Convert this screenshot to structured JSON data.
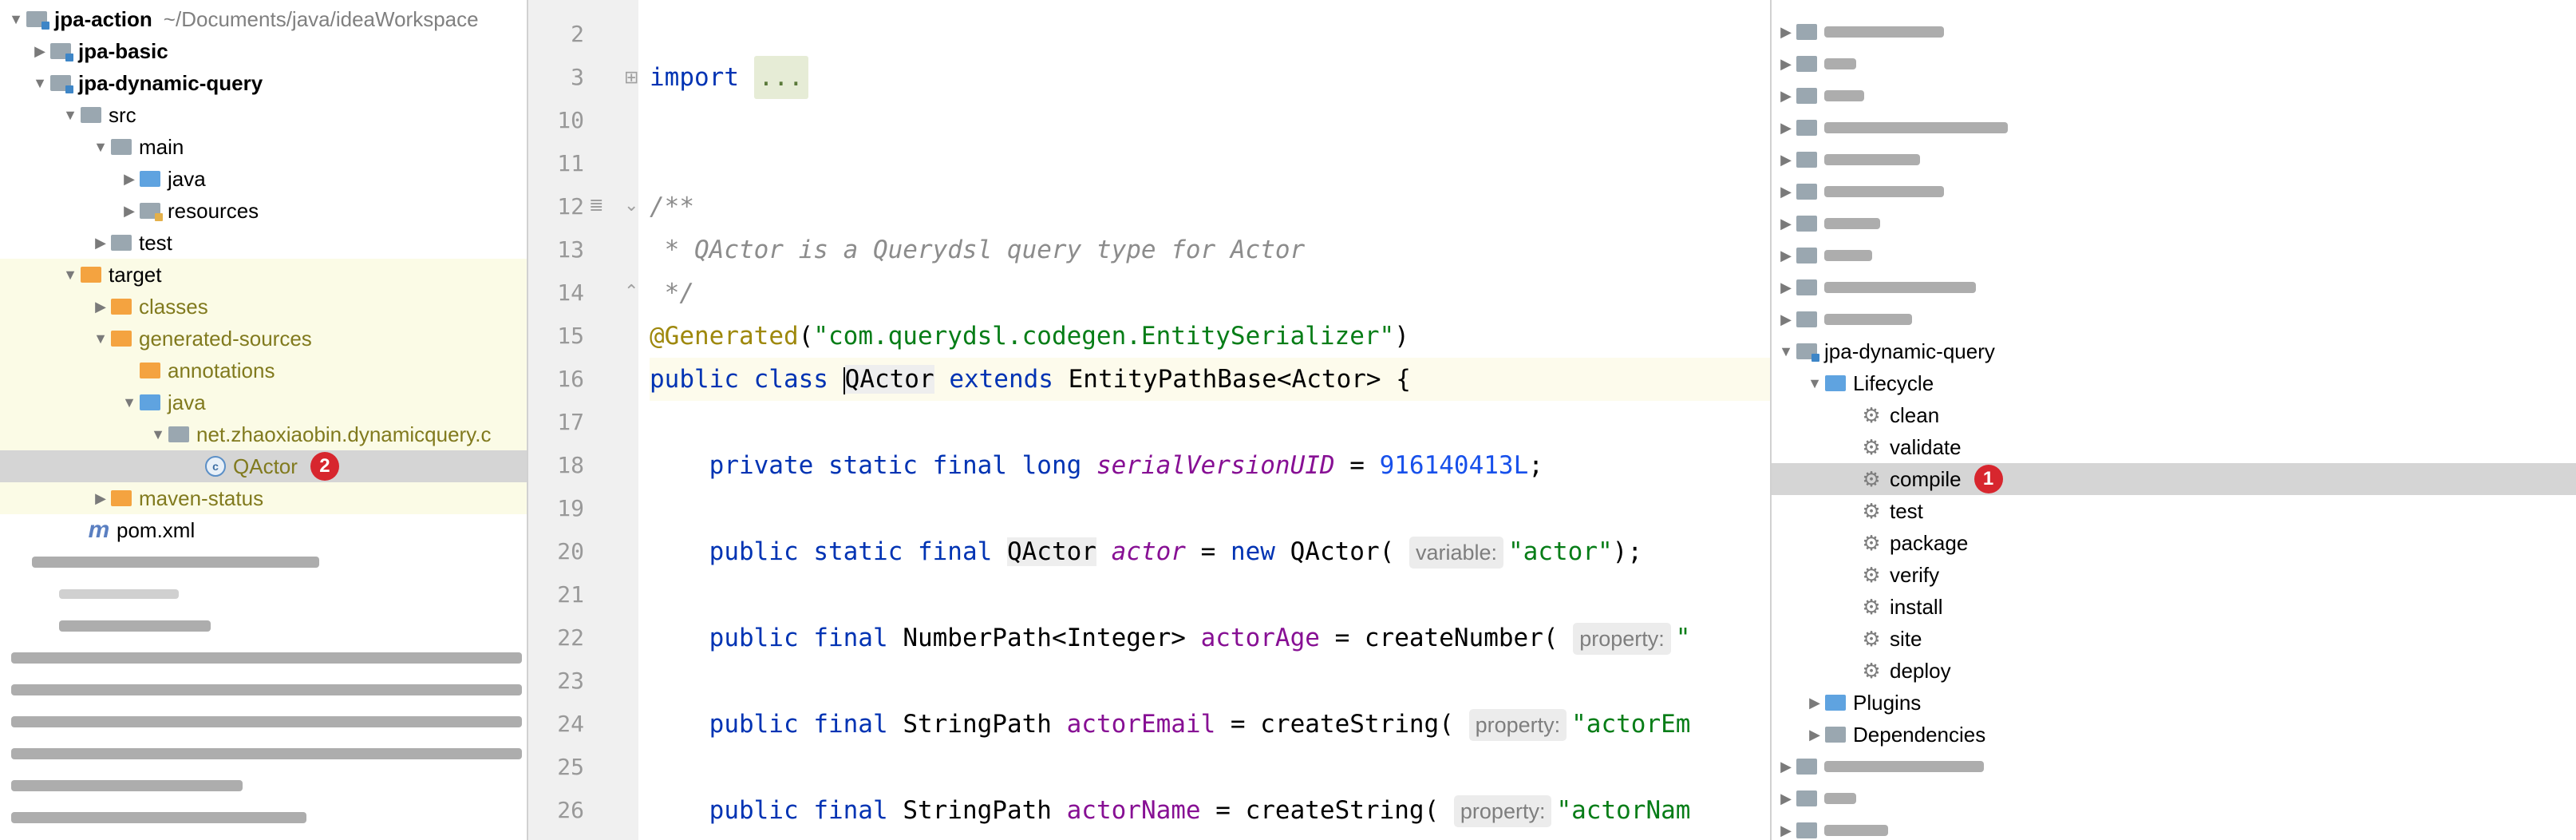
{
  "project_tree": {
    "items": [
      {
        "label": "jpa-action",
        "path": "~/Documents/java/ideaWorkspace"
      },
      {
        "label": "jpa-basic"
      },
      {
        "label": "jpa-dynamic-query"
      },
      {
        "label": "src"
      },
      {
        "label": "main"
      },
      {
        "label": "java"
      },
      {
        "label": "resources"
      },
      {
        "label": "test"
      },
      {
        "label": "target"
      },
      {
        "label": "classes"
      },
      {
        "label": "generated-sources"
      },
      {
        "label": "annotations"
      },
      {
        "label": "java"
      },
      {
        "label": "net.zhaoxiaobin.dynamicquery.c"
      },
      {
        "label": "QActor",
        "badge": "2"
      },
      {
        "label": "maven-status"
      },
      {
        "label": "pom.xml"
      }
    ]
  },
  "editor": {
    "lines": [
      {
        "n": "2"
      },
      {
        "n": "3",
        "t": "import ..."
      },
      {
        "n": "10"
      },
      {
        "n": "11"
      },
      {
        "n": "12",
        "t": "/**"
      },
      {
        "n": "13",
        "t": " * QActor is a Querydsl query type for Actor"
      },
      {
        "n": "14",
        "t": " */"
      },
      {
        "n": "15",
        "t": "@Generated(\"com.querydsl.codegen.EntitySerializer\")"
      },
      {
        "n": "16",
        "t": "public class QActor extends EntityPathBase<Actor> {"
      },
      {
        "n": "17"
      },
      {
        "n": "18",
        "t": "private static final long serialVersionUID = 916140413L;"
      },
      {
        "n": "19"
      },
      {
        "n": "20",
        "t": "public static final QActor actor = new QActor( variable: \"actor\");"
      },
      {
        "n": "21"
      },
      {
        "n": "22",
        "t": "public final NumberPath<Integer> actorAge = createNumber( property: \""
      },
      {
        "n": "23"
      },
      {
        "n": "24",
        "t": "public final StringPath actorEmail = createString( property: \"actorEm"
      },
      {
        "n": "25"
      },
      {
        "n": "26",
        "t": "public final StringPath actorName = createString( property: \"actorNam"
      }
    ],
    "tokens": {
      "import_kw": "import",
      "import_fold": "...",
      "jd_open": "/**",
      "jd_text": " * QActor is a Querydsl query type for Actor",
      "jd_close": " */",
      "ann_at": "@",
      "ann_name": "Generated",
      "ann_paren_open": "(",
      "ann_str": "\"com.querydsl.codegen.EntitySerializer\"",
      "ann_paren_close": ")",
      "public": "public",
      "class": "class",
      "cls_name": "QActor",
      "extends": "extends",
      "base": "EntityPathBase<Actor> {",
      "private": "private",
      "static": "static",
      "final": "final",
      "long": "long",
      "serial": "serialVersionUID",
      "eq": " = ",
      "serial_val": "916140413L",
      "semi": ";",
      "qactor": "QActor",
      "actor": "actor",
      "new": "new",
      "qactor_call": "QActor(",
      "hint_variable": "variable:",
      "actor_str": "\"actor\"",
      "close_semi": ");",
      "numberpath": "NumberPath<Integer>",
      "actorAge": "actorAge",
      "createNumber": " = createNumber(",
      "hint_property": "property:",
      "age_str": "\"",
      "stringpath": "StringPath",
      "actorEmail": "actorEmail",
      "createString": " = createString(",
      "email_str": "\"actorEm",
      "actorName": "actorName",
      "name_str": "\"actorNam"
    }
  },
  "maven_tree": {
    "module": "jpa-dynamic-query",
    "lifecycle": "Lifecycle",
    "goals": [
      "clean",
      "validate",
      "compile",
      "test",
      "package",
      "verify",
      "install",
      "site",
      "deploy"
    ],
    "selected_goal": "compile",
    "selected_badge": "1",
    "plugins": "Plugins",
    "dependencies": "Dependencies"
  },
  "colors": {
    "badge": "#d7262e",
    "selection": "#d5d5d5",
    "target_highlight": "#fbfbe6",
    "keyword": "#0033b3",
    "string": "#067d17"
  }
}
